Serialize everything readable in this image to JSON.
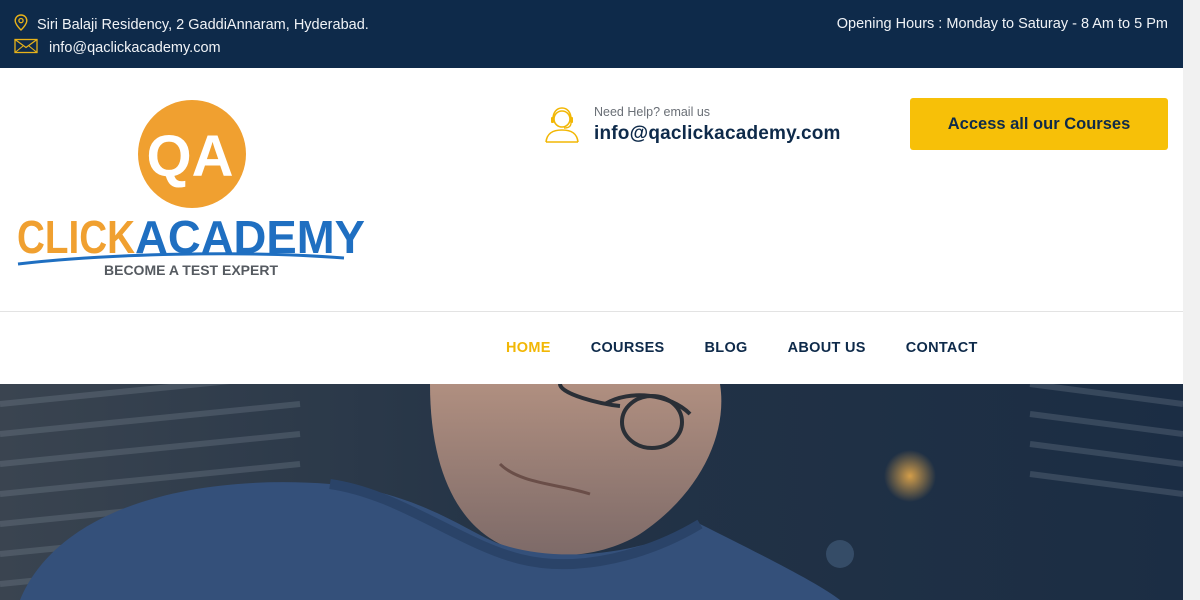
{
  "topbar": {
    "address": "Siri Balaji Residency, 2 GaddiAnnaram, Hyderabad.",
    "email": "info@qaclickacademy.com",
    "hours": "Opening Hours : Monday to Saturay - 8 Am to 5 Pm",
    "address_icon": "map-pin-icon",
    "email_icon": "envelope-icon"
  },
  "logo": {
    "badge_text": "QA",
    "brand_left": "CLICK",
    "brand_right": "ACADEMY",
    "tagline": "BECOME A TEST EXPERT"
  },
  "help": {
    "label": "Need Help? email us",
    "email": "info@qaclickacademy.com",
    "icon": "support-agent-icon"
  },
  "cta": {
    "label": "Access all our Courses"
  },
  "nav": {
    "items": [
      {
        "label": "HOME",
        "active": true
      },
      {
        "label": "COURSES",
        "active": false
      },
      {
        "label": "BLOG",
        "active": false
      },
      {
        "label": "ABOUT US",
        "active": false
      },
      {
        "label": "CONTACT",
        "active": false
      }
    ]
  },
  "colors": {
    "topbar_bg": "#0e2a4a",
    "accent_yellow": "#f7c008",
    "nav_active": "#f2b705",
    "logo_orange": "#f0a030",
    "logo_blue": "#1f6fc1"
  }
}
